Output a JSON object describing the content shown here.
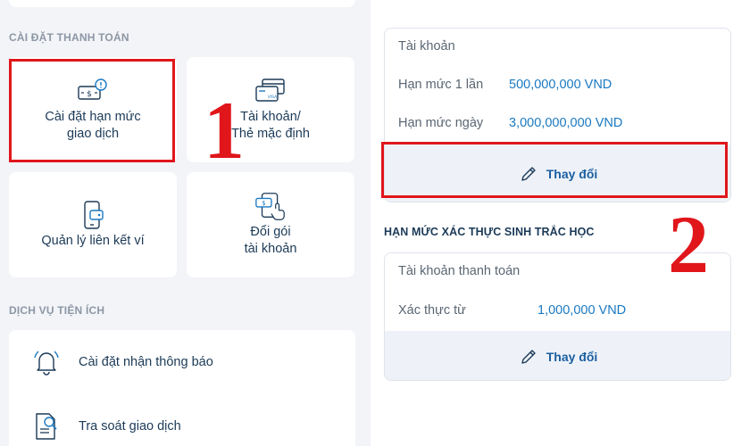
{
  "left": {
    "payment_settings_label": "CÀI ĐẶT THANH TOÁN",
    "tiles": [
      {
        "lines": [
          "Cài đặt hạn mức",
          "giao dịch"
        ],
        "icon": "money-alert-icon"
      },
      {
        "lines": [
          "Tài khoản/",
          "Thẻ mặc định"
        ],
        "icon": "cards-icon"
      },
      {
        "lines": [
          "Quản lý liên kết ví"
        ],
        "icon": "phone-wallet-icon"
      },
      {
        "lines": [
          "Đổi gói",
          "tài khoản"
        ],
        "icon": "phone-swap-icon"
      }
    ],
    "utility_services_label": "DỊCH VỤ TIỆN ÍCH",
    "list": [
      {
        "label": "Cài đặt nhận thông báo",
        "icon": "bell-icon"
      },
      {
        "label": "Tra soát giao dịch",
        "icon": "document-search-icon"
      }
    ]
  },
  "right": {
    "account_card": {
      "title": "Tài khoản",
      "rows": [
        {
          "label": "Hạn mức 1 lần",
          "value": "500,000,000 VND"
        },
        {
          "label": "Hạn mức ngày",
          "value": "3,000,000,000 VND"
        }
      ],
      "button_label": "Thay đổi"
    },
    "biometric_title": "HẠN MỨC XÁC THỰC SINH TRẮC HỌC",
    "biometric_card": {
      "title": "Tài khoản thanh toán",
      "rows": [
        {
          "label": "Xác thực từ",
          "value": "1,000,000 VND"
        }
      ],
      "button_label": "Thay đổi"
    }
  },
  "annotations": {
    "step1": "1",
    "step2": "2"
  },
  "colors": {
    "accent_blue": "#1a79c2",
    "highlight_red": "#e0161b",
    "panel_bg": "#f2f4f8"
  }
}
